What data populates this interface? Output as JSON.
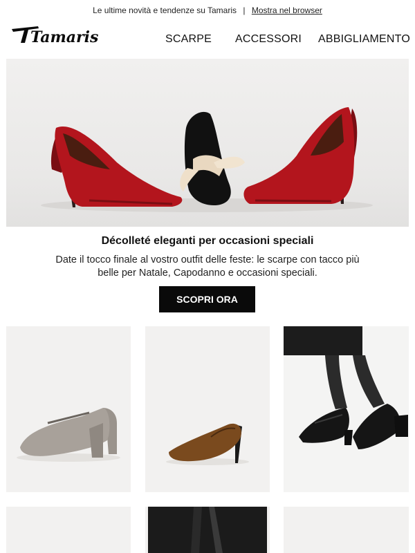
{
  "preheader": {
    "text": "Le ultime novità e tendenze su Tamaris",
    "separator": "|",
    "browser_link": "Mostra nel browser"
  },
  "brand": {
    "logo_text": "Tamaris"
  },
  "nav": {
    "items": [
      "SCARPE",
      "ACCESSORI",
      "ABBIGLIAMENTO"
    ]
  },
  "hero": {
    "headline": "Décolleté eleganti per occasioni speciali",
    "body": "Date il tocco finale al vostro outfit delle feste: le scarpe con tacco più belle per Natale, Capodanno e occasioni speciali.",
    "cta": "SCOPRI ORA"
  },
  "colors": {
    "accent_red": "#b3151d",
    "button_bg": "#0a0a0a",
    "tile_bg": "#f2f1f0"
  },
  "products": [
    {
      "icon": "grey-mary-jane-pump-icon"
    },
    {
      "icon": "brown-pump-icon"
    },
    {
      "icon": "black-mary-jane-worn-icon"
    },
    {
      "icon": "product-image-placeholder-icon"
    },
    {
      "icon": "black-skirt-legs-icon"
    },
    {
      "icon": "product-image-placeholder-icon"
    }
  ]
}
